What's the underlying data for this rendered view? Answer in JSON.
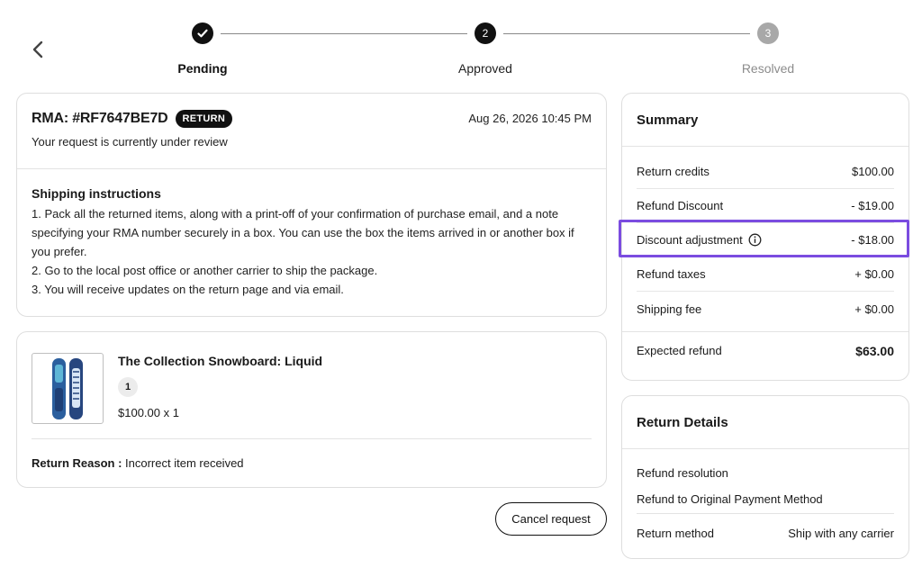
{
  "stepper": {
    "steps": [
      {
        "label": "Pending",
        "number": "",
        "state": "done"
      },
      {
        "label": "Approved",
        "number": "2",
        "state": "active"
      },
      {
        "label": "Resolved",
        "number": "3",
        "state": "pending"
      }
    ]
  },
  "rma": {
    "title": "RMA: #RF7647BE7D",
    "badge": "RETURN",
    "date": "Aug 26, 2026 10:45 PM",
    "status_text": "Your request is currently under review"
  },
  "shipping": {
    "title": "Shipping instructions",
    "lines": [
      "1. Pack all the returned items, along with a print-off of your confirmation of purchase email, and a note specifying your RMA number securely in a box. You can use the box the items arrived in or another box if you prefer.",
      "2. Go to the local post office or another carrier to ship the package.",
      "3. You will receive updates on the return page and via email."
    ]
  },
  "product": {
    "name": "The Collection Snowboard: Liquid",
    "quantity": "1",
    "price": "$100.00 x 1",
    "reason_label": "Return Reason :",
    "reason_value": "Incorrect item received"
  },
  "actions": {
    "cancel_label": "Cancel request"
  },
  "summary": {
    "title": "Summary",
    "rows": [
      {
        "label": "Return credits",
        "value": "$100.00"
      },
      {
        "label": "Refund Discount",
        "value": "- $19.00"
      },
      {
        "label": "Discount adjustment",
        "value": "- $18.00"
      },
      {
        "label": "Refund taxes",
        "value": "+ $0.00"
      },
      {
        "label": "Shipping fee",
        "value": "+ $0.00"
      }
    ],
    "expected_label": "Expected refund",
    "expected_value": "$63.00",
    "highlight_color": "#7b4ce0"
  },
  "return_details": {
    "title": "Return Details",
    "resolution_label": "Refund resolution",
    "resolution_value": "Refund to Original Payment Method",
    "method_label": "Return method",
    "method_value": "Ship with any carrier"
  }
}
